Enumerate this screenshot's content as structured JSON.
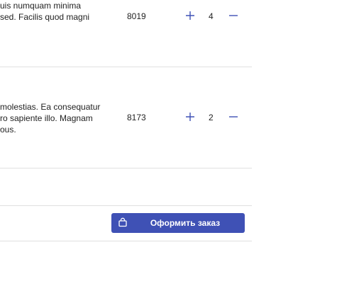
{
  "cart": {
    "items": [
      {
        "description": "uis numquam minima\nsed. Facilis quod magni",
        "price": "8019",
        "quantity": "4"
      },
      {
        "description": "molestias. Ea consequatur\nro sapiente illo. Magnam\nous.",
        "price": "8173",
        "quantity": "2"
      }
    ],
    "order_button": {
      "label": "Оформить заказ"
    }
  },
  "colors": {
    "accent": "#3f51b5",
    "divider": "#e0e0e0",
    "text": "#222222"
  },
  "icons": {
    "increase": "plus-icon",
    "decrease": "minus-icon",
    "order": "shopping-bag-icon"
  }
}
